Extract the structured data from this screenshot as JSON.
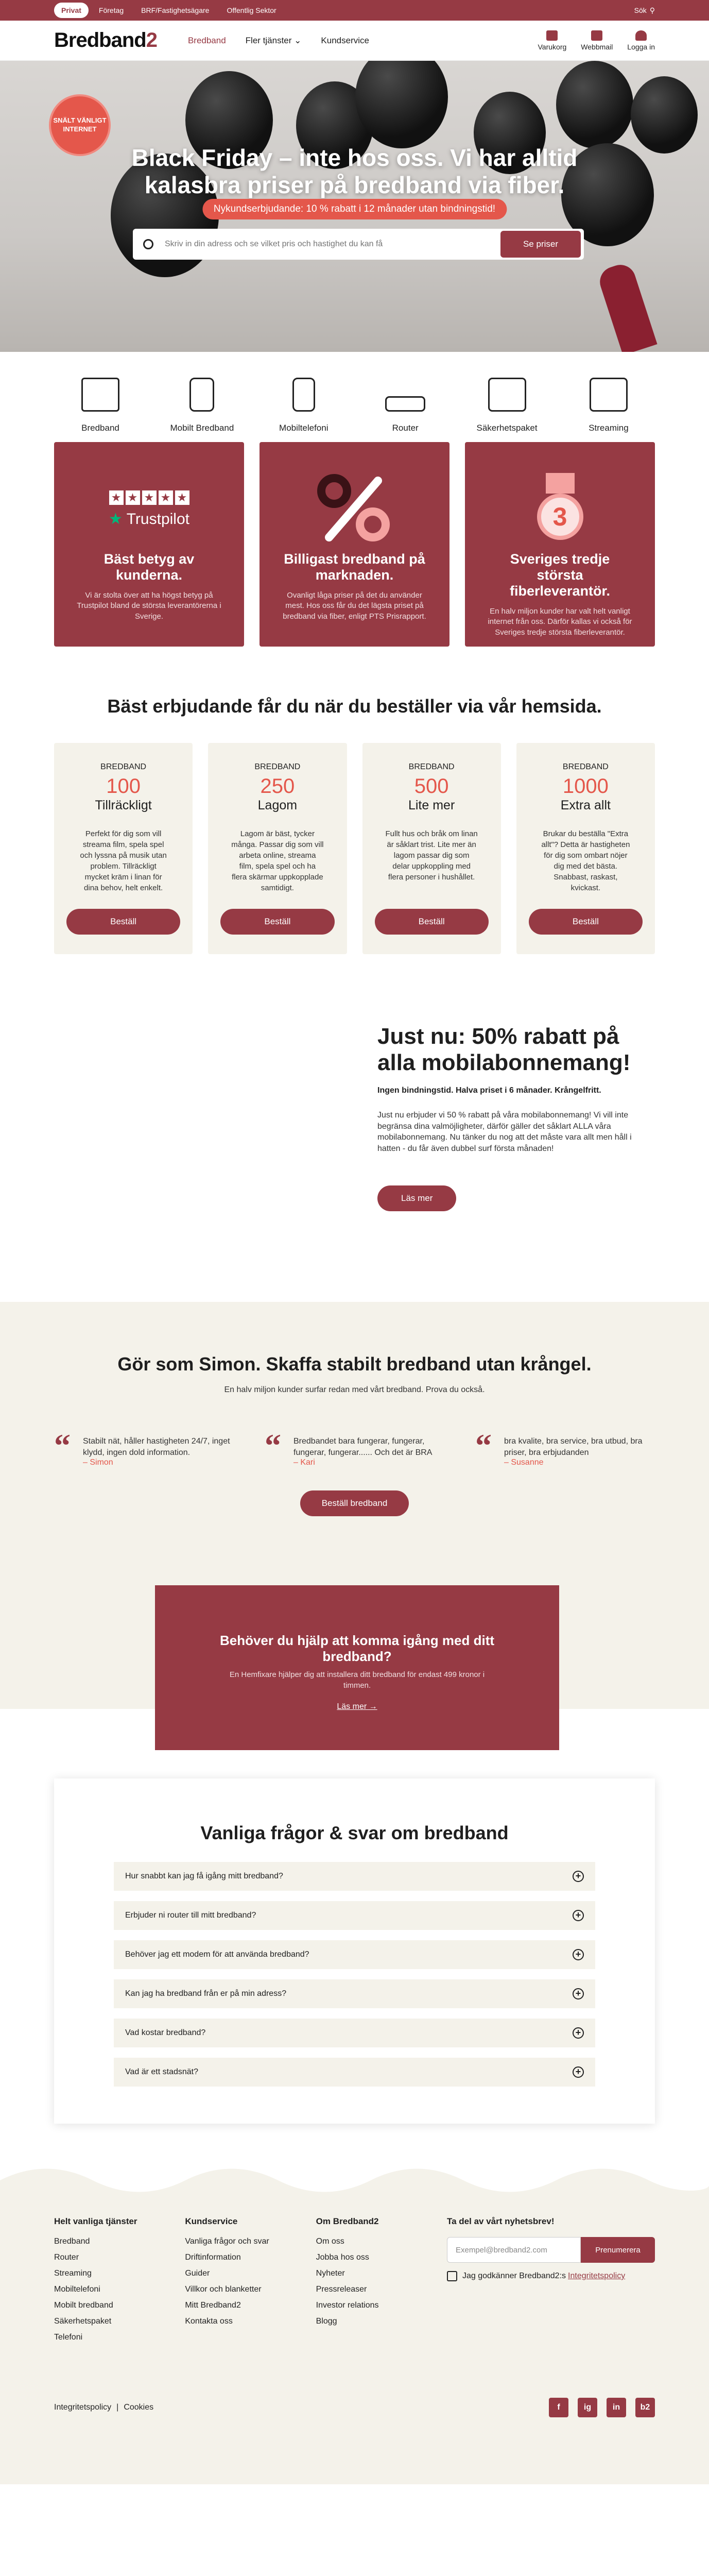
{
  "topbar": {
    "segments": [
      "Privat",
      "Företag",
      "BRF/Fastighetsägare",
      "Offentlig Sektor"
    ],
    "search_label": "Sök"
  },
  "header": {
    "logo_text": "Bredband",
    "logo_accent": "2",
    "nav": [
      "Bredband",
      "Fler tjänster",
      "Kundservice"
    ],
    "icons": [
      "Varukorg",
      "Webbmail",
      "Logga in"
    ]
  },
  "hero": {
    "badge": "SNÄLT VÄNLIGT INTERNET",
    "title": "Black Friday – inte hos oss. Vi har alltid kalasbra priser på bredband via fiber.",
    "pill": "Nykundserbjudande: 10 % rabatt i 12 månader utan bindningstid!",
    "search_placeholder": "Skriv in din adress och se vilket pris och hastighet du kan få",
    "search_button": "Se priser"
  },
  "categories": [
    "Bredband",
    "Mobilt Bredband",
    "Mobiltelefoni",
    "Router",
    "Säkerhetspaket",
    "Streaming"
  ],
  "features": [
    {
      "title": "Bäst betyg av kunderna.",
      "text": "Vi är stolta över att ha högst betyg på Trustpilot bland de största leverantörerna i Sverige.",
      "icon_text": "Trustpilot"
    },
    {
      "title": "Billigast bredband på marknaden.",
      "text": "Ovanligt låga priser på det du använder mest. Hos oss får du det lägsta priset på bredband via fiber, enligt PTS Prisrapport."
    },
    {
      "title": "Sveriges tredje största fiberleverantör.",
      "text": "En halv miljon kunder har valt helt vanligt internet från oss. Därför kallas vi också för Sveriges tredje största fiberleverantör.",
      "icon_text": "3"
    }
  ],
  "offers": {
    "title": "Bäst erbjudande får du när du beställer via vår hemsida.",
    "items": [
      {
        "category": "BREDBAND",
        "speed": "100",
        "name": "Tillräckligt",
        "desc": "Perfekt för dig som vill streama film, spela spel och lyssna på musik utan problem. Tillräckligt mycket kräm i linan för dina behov, helt enkelt.",
        "button": "Beställ"
      },
      {
        "category": "BREDBAND",
        "speed": "250",
        "name": "Lagom",
        "desc": "Lagom är bäst, tycker många. Passar dig som vill arbeta online, streama film, spela spel och ha flera skärmar uppkopplade samtidigt.",
        "button": "Beställ"
      },
      {
        "category": "BREDBAND",
        "speed": "500",
        "name": "Lite mer",
        "desc": "Fullt hus och bråk om linan är såklart trist. Lite mer än lagom passar dig som delar uppkoppling med flera personer i hushållet.",
        "button": "Beställ"
      },
      {
        "category": "BREDBAND",
        "speed": "1000",
        "name": "Extra allt",
        "desc": "Brukar du beställa \"Extra allt\"? Detta är hastigheten för dig som ombart nöjer dig med det bästa. Snabbast, raskast, kvickast.",
        "button": "Beställ"
      }
    ]
  },
  "mobile": {
    "title": "Just nu: 50% rabatt på alla mobilabonnemang!",
    "sub": "Ingen bindningstid. Halva priset i 6 månader. Krångelfritt.",
    "text": "Just nu erbjuder vi 50 % rabatt på våra mobilabonnemang! Vi vill inte begränsa dina valmöjligheter, därför gäller det såklart ALLA våra mobilabonnemang. Nu tänker du nog att det måste vara allt men håll i hatten - du får även dubbel surf första månaden!",
    "button": "Läs mer"
  },
  "simon": {
    "title": "Gör som Simon. Skaffa stabilt bredband utan krångel.",
    "sub": "En halv miljon kunder surfar redan med vårt bredband. Prova du också.",
    "quotes": [
      {
        "text": "Stabilt nät, håller hastigheten 24/7, inget klydd, ingen dold information.",
        "author": "– Simon"
      },
      {
        "text": "Bredbandet bara fungerar, fungerar, fungerar, fungerar...... Och det är BRA",
        "author": "– Kari"
      },
      {
        "text": "bra kvalite, bra service, bra utbud, bra priser, bra erbjudanden",
        "author": "– Susanne"
      }
    ],
    "button": "Beställ bredband"
  },
  "help": {
    "title": "Behöver du hjälp att komma igång med ditt bredband?",
    "text": "En Hemfixare hjälper dig att installera ditt bredband för endast 499 kronor i timmen.",
    "link": "Läs mer →"
  },
  "faq": {
    "title": "Vanliga frågor & svar om bredband",
    "items": [
      "Hur snabbt kan jag få igång mitt bredband?",
      "Erbjuder ni router till mitt bredband?",
      "Behöver jag ett modem för att använda bredband?",
      "Kan jag ha bredband från er på min adress?",
      "Vad kostar bredband?",
      "Vad är ett stadsnät?"
    ]
  },
  "footer": {
    "cols": [
      {
        "title": "Helt vanliga tjänster",
        "items": [
          "Bredband",
          "Router",
          "Streaming",
          "Mobiltelefoni",
          "Mobilt bredband",
          "Säkerhetspaket",
          "Telefoni"
        ]
      },
      {
        "title": "Kundservice",
        "items": [
          "Vanliga frågor och svar",
          "Driftinformation",
          "Guider",
          "Villkor och blanketter",
          "Mitt Bredband2",
          "Kontakta oss"
        ]
      },
      {
        "title": "Om Bredband2",
        "items": [
          "Om oss",
          "Jobba hos oss",
          "Nyheter",
          "Pressreleaser",
          "Investor relations",
          "Blogg"
        ]
      }
    ],
    "newsletter": {
      "title": "Ta del av vårt nyhetsbrev!",
      "placeholder": "Exempel@bredband2.com",
      "button": "Prenumerera",
      "consent": "Jag godkänner Bredband2:s",
      "consent_link": "Integritetspolicy"
    },
    "bottom_links": [
      "Integritetspolicy",
      "|",
      "Cookies"
    ],
    "socials": [
      "f",
      "ig",
      "in",
      "b2"
    ]
  }
}
